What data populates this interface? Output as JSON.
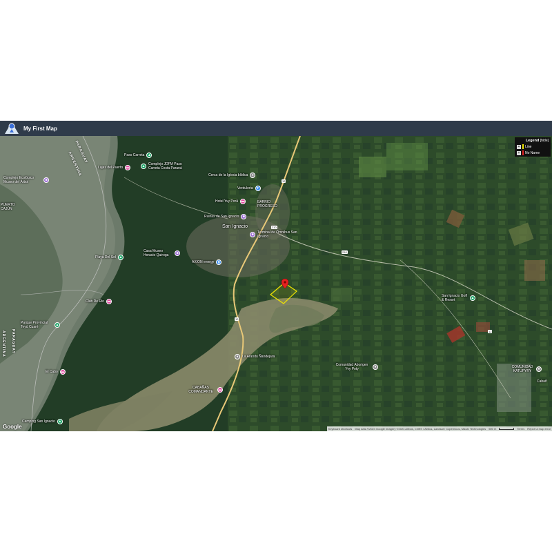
{
  "app": {
    "title": "My First Map"
  },
  "legend": {
    "title": "Legend",
    "hide": "[hide]",
    "items": [
      {
        "label": "Line",
        "color": "#f2e600"
      },
      {
        "label": "No Name",
        "color": "#e52020"
      }
    ]
  },
  "map": {
    "town": "San Ignacio",
    "countries": [
      "ARGENTINA",
      "PARAGUAY",
      "ARGENTINA",
      "PARAGUAY"
    ],
    "roads": [
      "12",
      "210",
      "210",
      "12",
      "12"
    ],
    "pois": [
      {
        "label": "Paso Carreta",
        "icon": "park-icon",
        "color": "#1aa566"
      },
      {
        "label": "Lajas del Puerto",
        "icon": "hotel-icon",
        "color": "#e04aa0"
      },
      {
        "label": "Complejo JDFM Paso Carreta Costa Paraná",
        "icon": "park-icon",
        "color": "#1aa566"
      },
      {
        "label": "Complejo Ecológico Museo del Árbol",
        "icon": "museum-icon",
        "color": "#9c6bd6"
      },
      {
        "label": "Cerca de la Iglesia bíblica",
        "icon": "place-icon",
        "color": "#8a8a8a"
      },
      {
        "label": "Verduleria",
        "icon": "shop-icon",
        "color": "#3b8ef0"
      },
      {
        "label": "Hotel Yvy Porã",
        "icon": "hotel-icon",
        "color": "#e04aa0"
      },
      {
        "label": "BARRIO PROGRESO",
        "icon": "",
        "color": ""
      },
      {
        "label": "Ruinas de San Ignacio",
        "icon": "museum-icon",
        "color": "#9c6bd6"
      },
      {
        "label": "Terminal de Ómnibus San Ignacio",
        "icon": "bus-icon",
        "color": "#9c6bd6"
      },
      {
        "label": "Casa Museo Horacio Quiroga",
        "icon": "museum-icon",
        "color": "#9c6bd6"
      },
      {
        "label": "AXION energy",
        "icon": "fuel-icon",
        "color": "#3b8ef0"
      },
      {
        "label": "Playa Del Sol",
        "icon": "park-icon",
        "color": "#1aa566"
      },
      {
        "label": "Club De Rio",
        "icon": "hotel-icon",
        "color": "#e04aa0"
      },
      {
        "label": "Parque Provincial Teyú Cuaré",
        "icon": "park-icon",
        "color": "#1aa566"
      },
      {
        "label": "San Ignacio Golf & Resort",
        "icon": "park-icon",
        "color": "#1aa566"
      },
      {
        "label": "La Arandu Ñandejara",
        "icon": "place-icon",
        "color": "#8a8a8a"
      },
      {
        "label": "Comunidad Aborigen Yvy Poty",
        "icon": "place-icon",
        "color": "#8a8a8a"
      },
      {
        "label": "COMUNIDAD KATUPYRY",
        "icon": "place-icon",
        "color": "#8a8a8a"
      },
      {
        "label": "El Cabo",
        "icon": "hotel-icon",
        "color": "#e04aa0"
      },
      {
        "label": "CABAÑAS COMANDANTE",
        "icon": "hotel-icon",
        "color": "#e04aa0"
      },
      {
        "label": "Camping San Ignacio",
        "icon": "park-icon",
        "color": "#1aa566"
      },
      {
        "label": "PUERTO CAJÚN",
        "icon": "",
        "color": ""
      },
      {
        "label": "Cabañ",
        "icon": "",
        "color": ""
      }
    ]
  },
  "attribution": {
    "google": "Google",
    "shortcuts": "Keyboard shortcuts",
    "data": "Map data ©2024 Google Imagery ©2024 Airbus, CNES / Airbus, Landsat / Copernicus, Maxar Technologies",
    "scale": "500 m",
    "terms": "Terms",
    "report": "Report a map error"
  }
}
